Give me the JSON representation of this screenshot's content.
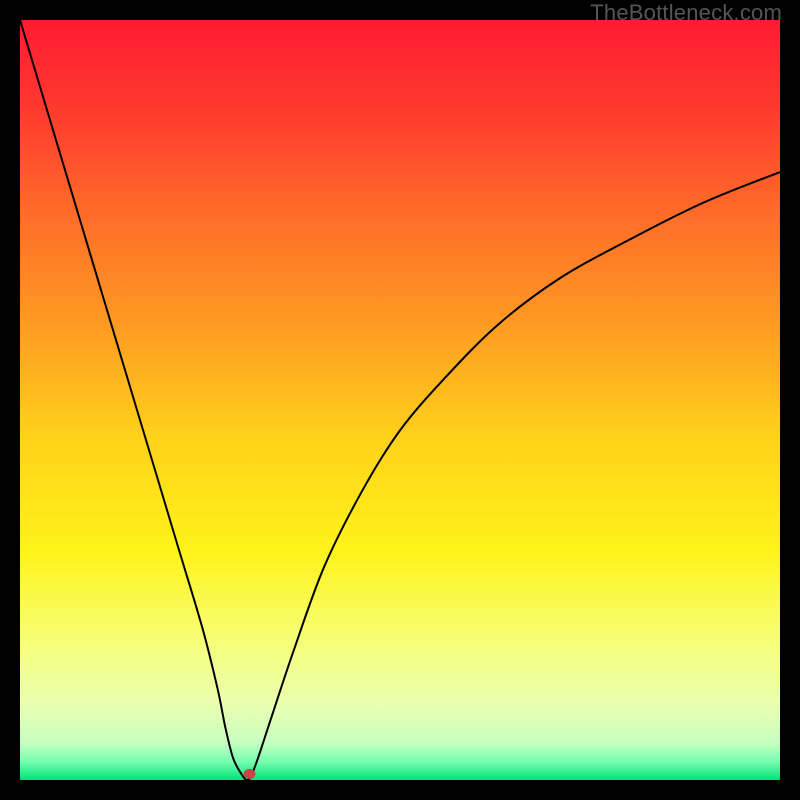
{
  "watermark": "TheBottleneck.com",
  "chart_data": {
    "type": "line",
    "title": "",
    "xlabel": "",
    "ylabel": "",
    "xlim": [
      0,
      100
    ],
    "ylim": [
      0,
      100
    ],
    "background_gradient": {
      "stops": [
        {
          "offset": 0.0,
          "color": "#ff1a33"
        },
        {
          "offset": 0.12,
          "color": "#ff3a2e"
        },
        {
          "offset": 0.25,
          "color": "#ff6a2a"
        },
        {
          "offset": 0.4,
          "color": "#ff9a22"
        },
        {
          "offset": 0.55,
          "color": "#ffd21a"
        },
        {
          "offset": 0.7,
          "color": "#fff31a"
        },
        {
          "offset": 0.82,
          "color": "#f6ff7a"
        },
        {
          "offset": 0.9,
          "color": "#eaffb0"
        },
        {
          "offset": 0.95,
          "color": "#c8ffc0"
        },
        {
          "offset": 0.975,
          "color": "#7affb0"
        },
        {
          "offset": 1.0,
          "color": "#00e37a"
        }
      ]
    },
    "series": [
      {
        "name": "curve",
        "color": "#000000",
        "stroke_width": 2,
        "x": [
          0,
          3,
          6,
          9,
          12,
          15,
          18,
          21,
          24,
          26,
          27,
          28,
          29,
          30,
          31,
          33,
          36,
          40,
          45,
          50,
          56,
          63,
          71,
          80,
          90,
          100
        ],
        "y": [
          100,
          90,
          80,
          70,
          60,
          50,
          40,
          30,
          20,
          12,
          7,
          3,
          1,
          0,
          2,
          8,
          17,
          28,
          38,
          46,
          53,
          60,
          66,
          71,
          76,
          80
        ]
      }
    ],
    "marker": {
      "name": "min-point",
      "x": 30.2,
      "y": 0.8,
      "rx": 6,
      "ry": 5,
      "fill": "#cc4444"
    }
  }
}
